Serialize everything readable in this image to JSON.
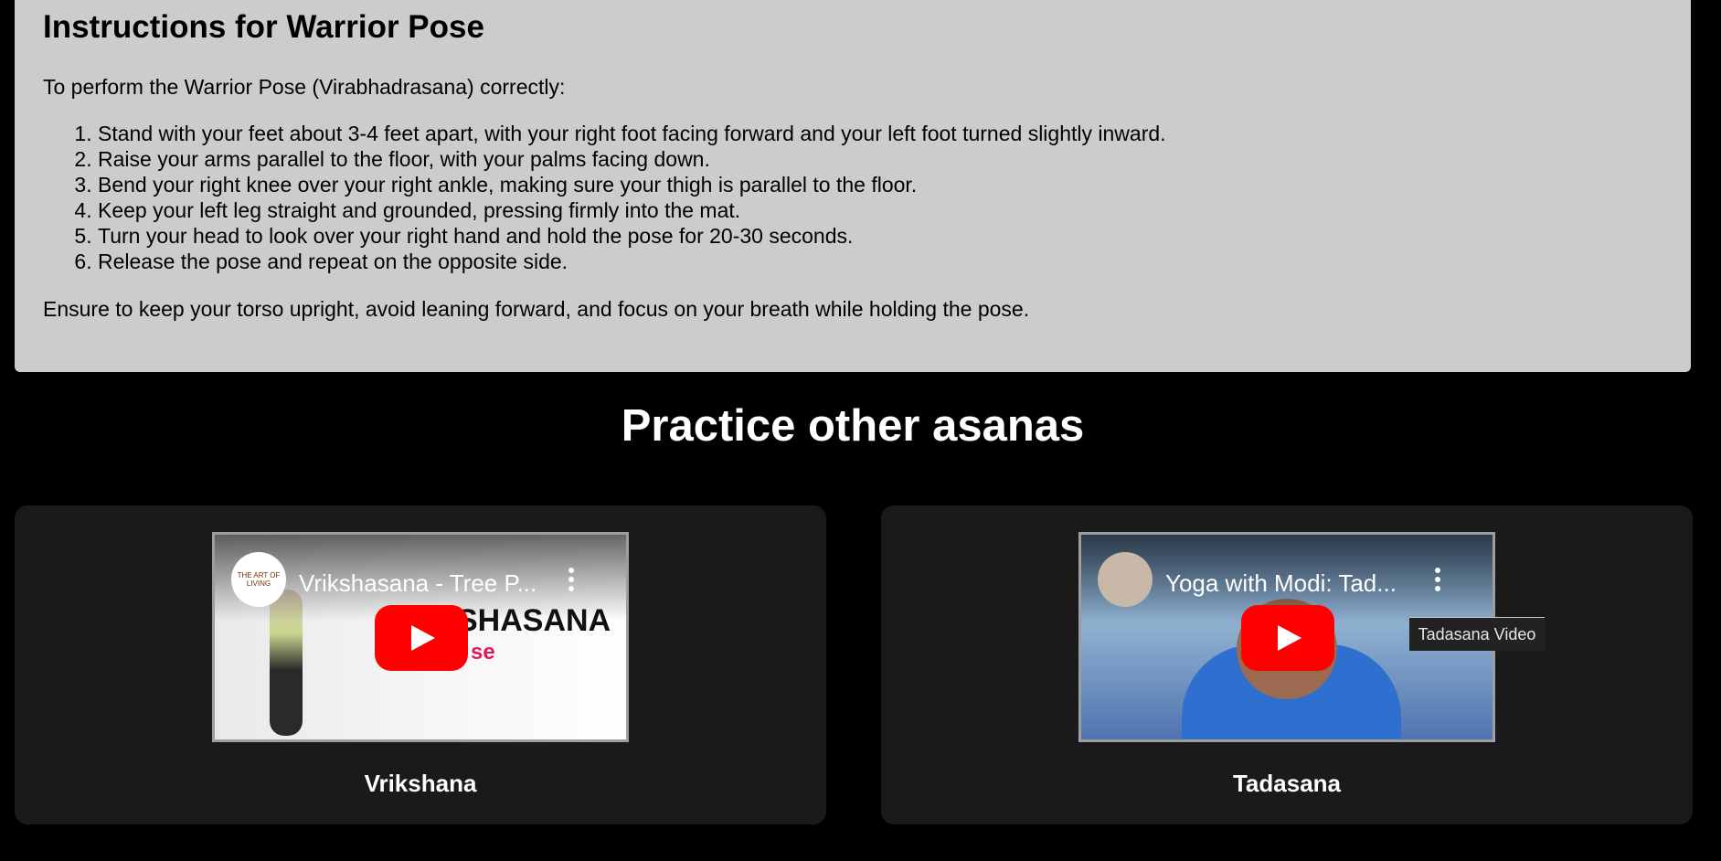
{
  "instructions": {
    "title": "Instructions for Warrior Pose",
    "intro": "To perform the Warrior Pose (Virabhadrasana) correctly:",
    "steps": [
      "Stand with your feet about 3-4 feet apart, with your right foot facing forward and your left foot turned slightly inward.",
      "Raise your arms parallel to the floor, with your palms facing down.",
      "Bend your right knee over your right ankle, making sure your thigh is parallel to the floor.",
      "Keep your left leg straight and grounded, pressing firmly into the mat.",
      "Turn your head to look over your right hand and hold the pose for 20-30 seconds.",
      "Release the pose and repeat on the opposite side."
    ],
    "outro": "Ensure to keep your torso upright, avoid leaning forward, and focus on your breath while holding the pose."
  },
  "practice": {
    "title": "Practice other asanas",
    "cards": [
      {
        "video_title": "Vrikshasana - Tree P...",
        "channel_text": "THE ART OF LIVING",
        "overlay_text": "SHASANA",
        "overlay_sub": "se",
        "caption": "Vrikshana"
      },
      {
        "video_title": "Yoga with Modi: Tad...",
        "caption": "Tadasana",
        "tooltip": "Tadasana Video"
      }
    ]
  },
  "colors": {
    "page_bg": "#000000",
    "instructions_bg": "#cccccc",
    "card_bg": "#1a1a1a",
    "play_button": "#ff0000"
  }
}
